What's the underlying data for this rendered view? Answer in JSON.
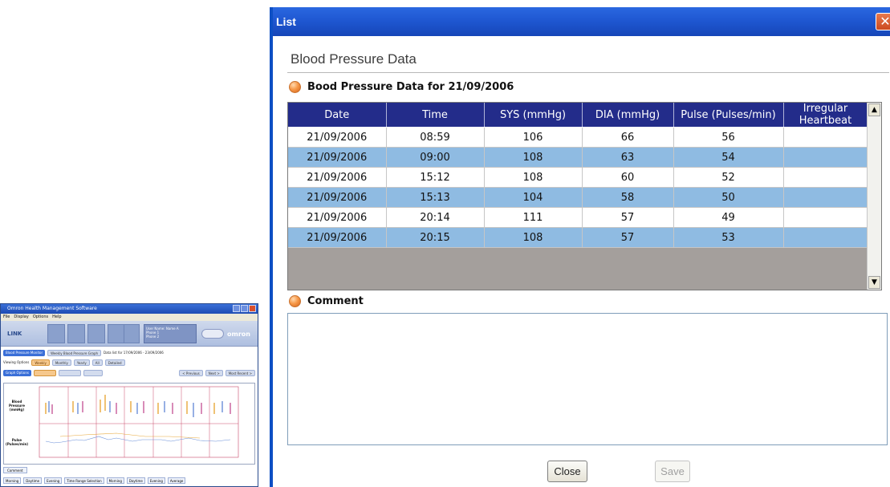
{
  "background_window": {
    "title": "Omron Health Management Software",
    "menu": [
      "File",
      "Display",
      "Options",
      "Help"
    ],
    "logo": "LINK",
    "brand": "omron",
    "user_panel": [
      "User Name:",
      "Name A",
      "Phone 1",
      "Phone 2"
    ],
    "tab_active": "Blood Pressure Monitor",
    "tab_other": "Weekly Blood Pressure Graph",
    "date_range": "Data list for 17/09/2006 - 23/09/2006",
    "viewing_options_label": "Viewing Options",
    "view_buttons": [
      "Weekly",
      "Monthly",
      "Yearly",
      "All",
      "Detailed"
    ],
    "graph_options_label": "Graph Options",
    "nav_buttons": [
      "< Previous",
      "Next >",
      "Most Recent >"
    ],
    "y_label_bp": "Blood Pressure (mmHg)",
    "y_label_pulse": "Pulse (Pulses/min)",
    "comment_label": "Comment",
    "bottom_items": [
      "Morning",
      "Daytime",
      "Evening",
      "Time Range Selection",
      "Morning",
      "Daytime",
      "Evening",
      "Average"
    ]
  },
  "dialog": {
    "title": "List",
    "close_glyph": "✕",
    "heading": "Blood Pressure Data",
    "section_title": "Bood Pressure Data for 21/09/2006",
    "comment_title": "Comment",
    "comment_value": "",
    "columns": [
      "Date",
      "Time",
      "SYS (mmHg)",
      "DIA (mmHg)",
      "Pulse (Pulses/min)",
      "Irregular Heartbeat"
    ],
    "rows": [
      [
        "21/09/2006",
        "08:59",
        "106",
        "66",
        "56",
        ""
      ],
      [
        "21/09/2006",
        "09:00",
        "108",
        "63",
        "54",
        ""
      ],
      [
        "21/09/2006",
        "15:12",
        "108",
        "60",
        "52",
        ""
      ],
      [
        "21/09/2006",
        "15:13",
        "104",
        "58",
        "50",
        ""
      ],
      [
        "21/09/2006",
        "20:14",
        "111",
        "57",
        "49",
        ""
      ],
      [
        "21/09/2006",
        "20:15",
        "108",
        "57",
        "53",
        ""
      ]
    ],
    "scroll_up_glyph": "▲",
    "scroll_down_glyph": "▼",
    "close_label": "Close",
    "save_label": "Save"
  },
  "colors": {
    "title_bar": "#1e56d0",
    "table_header": "#232c8a",
    "row_highlight": "#8fbbe2",
    "grid_empty": "#a49f9c"
  }
}
